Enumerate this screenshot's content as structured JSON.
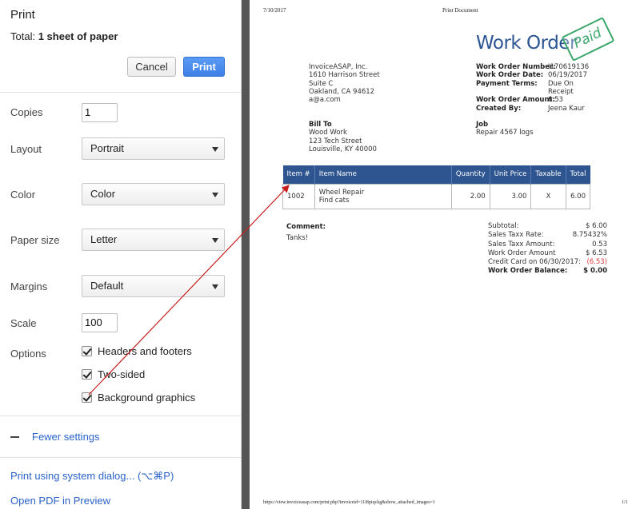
{
  "panel": {
    "title": "Print",
    "total_label": "Total:",
    "total_value": "1 sheet of paper",
    "cancel_label": "Cancel",
    "print_label": "Print",
    "copies_label": "Copies",
    "copies_value": "1",
    "layout_label": "Layout",
    "layout_value": "Portrait",
    "color_label": "Color",
    "color_value": "Color",
    "paper_size_label": "Paper size",
    "paper_size_value": "Letter",
    "margins_label": "Margins",
    "margins_value": "Default",
    "scale_label": "Scale",
    "scale_value": "100",
    "options_label": "Options",
    "options": [
      {
        "label": "Headers and footers",
        "checked": true
      },
      {
        "label": "Two-sided",
        "checked": true
      },
      {
        "label": "Background graphics",
        "checked": true
      }
    ],
    "fewer_settings": "Fewer settings",
    "system_dialog": "Print using system dialog... (⌥⌘P)",
    "open_pdf": "Open PDF in Preview"
  },
  "preview": {
    "header_date": "7/10/2017",
    "header_title": "Print Document",
    "footer_url": "https://view.invoiceasap.com/print.php?invoiceid=11i8piqckg&show_attached_images=1",
    "footer_page": "1/1",
    "doc_title": "Work Order",
    "stamp": "Paid",
    "company": [
      "InvoiceASAP, Inc.",
      "1610 Harrison Street",
      "Suite C",
      "Oakland, CA 94612",
      "a@a.com"
    ],
    "bill_to_label": "Bill To",
    "bill_to": [
      "Wood Work",
      "123 Tech Street",
      "Louisville, KY 40000"
    ],
    "details": [
      {
        "label": "Work Order Number:",
        "value": "I170619136"
      },
      {
        "label": "Work Order Date:",
        "value": "06/19/2017"
      },
      {
        "label": "Payment Terms:",
        "value": "Due On"
      },
      {
        "label": "",
        "value": "Receipt"
      },
      {
        "label": "Work Order Amount:",
        "value": "6.53"
      },
      {
        "label": "Created By:",
        "value": "Jeena Kaur"
      }
    ],
    "job_label": "Job",
    "job_value": "Repair 4567 logs",
    "table": {
      "headers": [
        "Item #",
        "Item Name",
        "Quantity",
        "Unit Price",
        "Taxable",
        "Total"
      ],
      "rows": [
        {
          "item": "1002",
          "name": "Wheel Repair",
          "desc": "Find cats",
          "qty": "2.00",
          "price": "3.00",
          "taxable": "X",
          "total": "6.00"
        }
      ]
    },
    "comment_label": "Comment:",
    "comment_value": "Tanks!",
    "totals": [
      {
        "label": "Subtotal:",
        "value": "$ 6.00",
        "bold": false,
        "negative": false
      },
      {
        "label": "Sales Taxx Rate:",
        "value": "8.75432%",
        "bold": false,
        "negative": false
      },
      {
        "label": "Sales Taxx Amount:",
        "value": "0.53",
        "bold": false,
        "negative": false
      },
      {
        "label": "Work Order Amount",
        "value": "$ 6.53",
        "bold": false,
        "negative": false
      },
      {
        "label": "Credit Card on 06/30/2017:",
        "value": "(6.53)",
        "bold": false,
        "negative": true
      },
      {
        "label": "Work Order Balance:",
        "value": "$ 0.00",
        "bold": true,
        "negative": false
      }
    ]
  },
  "colors": {
    "accent_blue": "#2b5592",
    "link_blue": "#2a62c9",
    "stamp_green": "#3aa66a",
    "negative_red": "#e03b3b",
    "annotation_arrow": "#c81e1e"
  },
  "annotation": {
    "type": "arrow",
    "from": "background-graphics-checkbox",
    "to": "items-table-header"
  }
}
